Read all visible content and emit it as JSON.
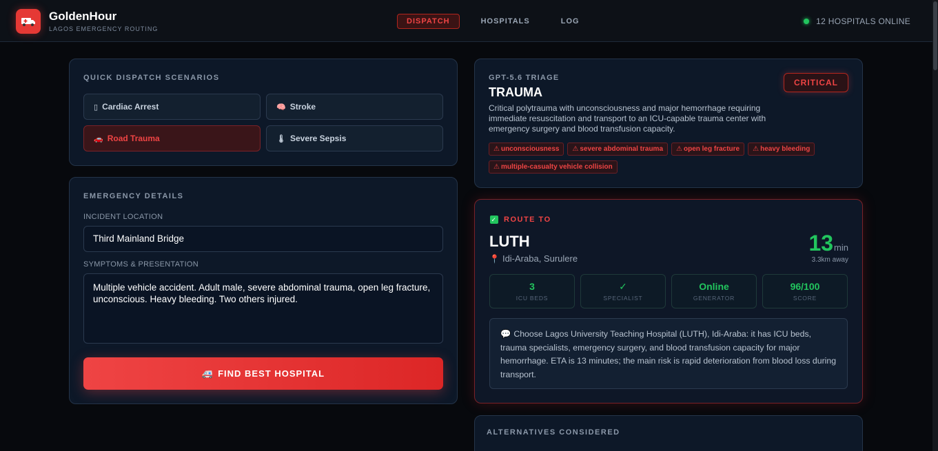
{
  "header": {
    "brand_title": "GoldenHour",
    "brand_subtitle": "LAGOS EMERGENCY ROUTING",
    "nav": [
      {
        "label": "DISPATCH",
        "active": true
      },
      {
        "label": "HOSPITALS",
        "active": false
      },
      {
        "label": "LOG",
        "active": false
      }
    ],
    "status_text": "12 HOSPITALS ONLINE"
  },
  "quick_dispatch": {
    "title": "QUICK DISPATCH SCENARIOS",
    "scenarios": [
      {
        "icon": "▯",
        "label": "Cardiac Arrest",
        "active": false
      },
      {
        "icon": "🧠",
        "label": "Stroke",
        "active": false
      },
      {
        "icon": "🚗",
        "label": "Road Trauma",
        "active": true
      },
      {
        "icon": "🌡",
        "label": "Severe Sepsis",
        "active": false
      }
    ]
  },
  "details": {
    "title": "EMERGENCY DETAILS",
    "location_label": "INCIDENT LOCATION",
    "location_value": "Third Mainland Bridge",
    "symptoms_label": "SYMPTOMS & PRESENTATION",
    "symptoms_value": "Multiple vehicle accident. Adult male, severe abdominal trauma, open leg fracture, unconscious. Heavy bleeding. Two others injured.",
    "find_button_icon": "🚑",
    "find_button_label": "FIND BEST HOSPITAL"
  },
  "triage": {
    "model_label": "GPT-5.6 TRIAGE",
    "category": "TRAUMA",
    "severity": "CRITICAL",
    "description": "Critical polytrauma with unconsciousness and major hemorrhage requiring immediate resuscitation and transport to an ICU-capable trauma center with emergency surgery and blood transfusion capacity.",
    "tags": [
      "unconsciousness",
      "severe abdominal trauma",
      "open leg fracture",
      "heavy bleeding",
      "multiple-casualty vehicle collision"
    ]
  },
  "route": {
    "label": "ROUTE TO",
    "hospital_name": "LUTH",
    "hospital_location": "Idi-Araba, Surulere",
    "eta_value": "13",
    "eta_unit": "min",
    "distance": "3.3km away",
    "stats": [
      {
        "value": "3",
        "label": "ICU BEDS"
      },
      {
        "value": "✓",
        "label": "SPECIALIST"
      },
      {
        "value": "Online",
        "label": "GENERATOR"
      },
      {
        "value": "96/100",
        "label": "SCORE"
      }
    ],
    "reasoning_icon": "💬",
    "reasoning": "Choose Lagos University Teaching Hospital (LUTH), Idi-Araba: it has ICU beds, trauma specialists, emergency surgery, and blood transfusion capacity for major hemorrhage. ETA is 13 minutes; the main risk is rapid deterioration from blood loss during transport."
  },
  "alternatives": {
    "title": "ALTERNATIVES CONSIDERED"
  },
  "colors": {
    "accent_red": "#ef4444",
    "success_green": "#22c55e",
    "background": "#07090d",
    "card": "#0d1828"
  }
}
